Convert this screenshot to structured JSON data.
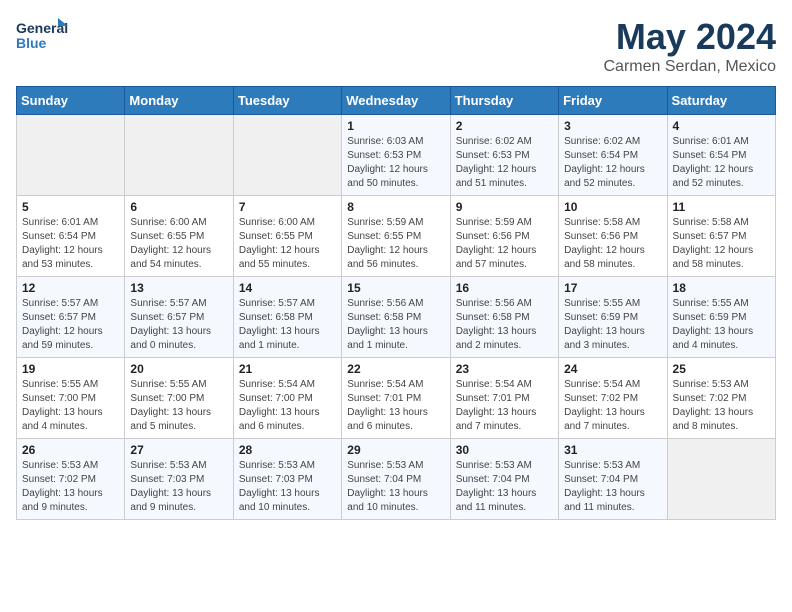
{
  "logo": {
    "line1": "General",
    "line2": "Blue"
  },
  "title": "May 2024",
  "subtitle": "Carmen Serdan, Mexico",
  "weekdays": [
    "Sunday",
    "Monday",
    "Tuesday",
    "Wednesday",
    "Thursday",
    "Friday",
    "Saturday"
  ],
  "weeks": [
    [
      {
        "day": "",
        "info": ""
      },
      {
        "day": "",
        "info": ""
      },
      {
        "day": "",
        "info": ""
      },
      {
        "day": "1",
        "info": "Sunrise: 6:03 AM\nSunset: 6:53 PM\nDaylight: 12 hours\nand 50 minutes."
      },
      {
        "day": "2",
        "info": "Sunrise: 6:02 AM\nSunset: 6:53 PM\nDaylight: 12 hours\nand 51 minutes."
      },
      {
        "day": "3",
        "info": "Sunrise: 6:02 AM\nSunset: 6:54 PM\nDaylight: 12 hours\nand 52 minutes."
      },
      {
        "day": "4",
        "info": "Sunrise: 6:01 AM\nSunset: 6:54 PM\nDaylight: 12 hours\nand 52 minutes."
      }
    ],
    [
      {
        "day": "5",
        "info": "Sunrise: 6:01 AM\nSunset: 6:54 PM\nDaylight: 12 hours\nand 53 minutes."
      },
      {
        "day": "6",
        "info": "Sunrise: 6:00 AM\nSunset: 6:55 PM\nDaylight: 12 hours\nand 54 minutes."
      },
      {
        "day": "7",
        "info": "Sunrise: 6:00 AM\nSunset: 6:55 PM\nDaylight: 12 hours\nand 55 minutes."
      },
      {
        "day": "8",
        "info": "Sunrise: 5:59 AM\nSunset: 6:55 PM\nDaylight: 12 hours\nand 56 minutes."
      },
      {
        "day": "9",
        "info": "Sunrise: 5:59 AM\nSunset: 6:56 PM\nDaylight: 12 hours\nand 57 minutes."
      },
      {
        "day": "10",
        "info": "Sunrise: 5:58 AM\nSunset: 6:56 PM\nDaylight: 12 hours\nand 58 minutes."
      },
      {
        "day": "11",
        "info": "Sunrise: 5:58 AM\nSunset: 6:57 PM\nDaylight: 12 hours\nand 58 minutes."
      }
    ],
    [
      {
        "day": "12",
        "info": "Sunrise: 5:57 AM\nSunset: 6:57 PM\nDaylight: 12 hours\nand 59 minutes."
      },
      {
        "day": "13",
        "info": "Sunrise: 5:57 AM\nSunset: 6:57 PM\nDaylight: 13 hours\nand 0 minutes."
      },
      {
        "day": "14",
        "info": "Sunrise: 5:57 AM\nSunset: 6:58 PM\nDaylight: 13 hours\nand 1 minute."
      },
      {
        "day": "15",
        "info": "Sunrise: 5:56 AM\nSunset: 6:58 PM\nDaylight: 13 hours\nand 1 minute."
      },
      {
        "day": "16",
        "info": "Sunrise: 5:56 AM\nSunset: 6:58 PM\nDaylight: 13 hours\nand 2 minutes."
      },
      {
        "day": "17",
        "info": "Sunrise: 5:55 AM\nSunset: 6:59 PM\nDaylight: 13 hours\nand 3 minutes."
      },
      {
        "day": "18",
        "info": "Sunrise: 5:55 AM\nSunset: 6:59 PM\nDaylight: 13 hours\nand 4 minutes."
      }
    ],
    [
      {
        "day": "19",
        "info": "Sunrise: 5:55 AM\nSunset: 7:00 PM\nDaylight: 13 hours\nand 4 minutes."
      },
      {
        "day": "20",
        "info": "Sunrise: 5:55 AM\nSunset: 7:00 PM\nDaylight: 13 hours\nand 5 minutes."
      },
      {
        "day": "21",
        "info": "Sunrise: 5:54 AM\nSunset: 7:00 PM\nDaylight: 13 hours\nand 6 minutes."
      },
      {
        "day": "22",
        "info": "Sunrise: 5:54 AM\nSunset: 7:01 PM\nDaylight: 13 hours\nand 6 minutes."
      },
      {
        "day": "23",
        "info": "Sunrise: 5:54 AM\nSunset: 7:01 PM\nDaylight: 13 hours\nand 7 minutes."
      },
      {
        "day": "24",
        "info": "Sunrise: 5:54 AM\nSunset: 7:02 PM\nDaylight: 13 hours\nand 7 minutes."
      },
      {
        "day": "25",
        "info": "Sunrise: 5:53 AM\nSunset: 7:02 PM\nDaylight: 13 hours\nand 8 minutes."
      }
    ],
    [
      {
        "day": "26",
        "info": "Sunrise: 5:53 AM\nSunset: 7:02 PM\nDaylight: 13 hours\nand 9 minutes."
      },
      {
        "day": "27",
        "info": "Sunrise: 5:53 AM\nSunset: 7:03 PM\nDaylight: 13 hours\nand 9 minutes."
      },
      {
        "day": "28",
        "info": "Sunrise: 5:53 AM\nSunset: 7:03 PM\nDaylight: 13 hours\nand 10 minutes."
      },
      {
        "day": "29",
        "info": "Sunrise: 5:53 AM\nSunset: 7:04 PM\nDaylight: 13 hours\nand 10 minutes."
      },
      {
        "day": "30",
        "info": "Sunrise: 5:53 AM\nSunset: 7:04 PM\nDaylight: 13 hours\nand 11 minutes."
      },
      {
        "day": "31",
        "info": "Sunrise: 5:53 AM\nSunset: 7:04 PM\nDaylight: 13 hours\nand 11 minutes."
      },
      {
        "day": "",
        "info": ""
      }
    ]
  ]
}
